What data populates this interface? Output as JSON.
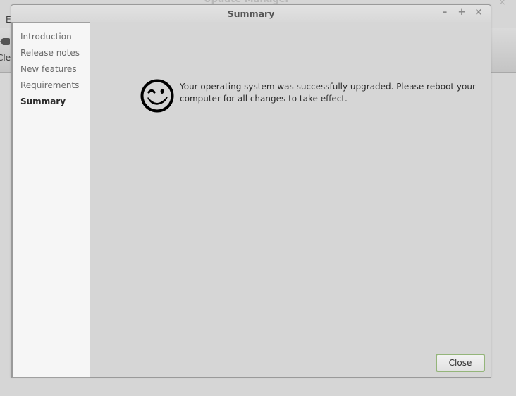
{
  "background_window": {
    "title": "Update Manager",
    "menu_label_partial": "E",
    "toolbar_label_partial": "Clea",
    "close_glyph": "×"
  },
  "dialog": {
    "title": "Summary",
    "window_controls": {
      "minimize": "–",
      "maximize": "+",
      "close": "×"
    },
    "sidebar": {
      "items": [
        {
          "label": "Introduction",
          "active": false
        },
        {
          "label": "Release notes",
          "active": false
        },
        {
          "label": "New features",
          "active": false
        },
        {
          "label": "Requirements",
          "active": false
        },
        {
          "label": "Summary",
          "active": true
        }
      ]
    },
    "message": {
      "icon": "wink-smiley-icon",
      "text": "Your operating system was successfully upgraded. Please reboot your computer for all changes to take effect."
    },
    "buttons": {
      "close_label": "Close"
    }
  },
  "colors": {
    "window_bg": "#d6d6d6",
    "sidebar_bg": "#f6f6f6",
    "button_focus_border": "#94b57a",
    "text": "#2a2a2a"
  }
}
